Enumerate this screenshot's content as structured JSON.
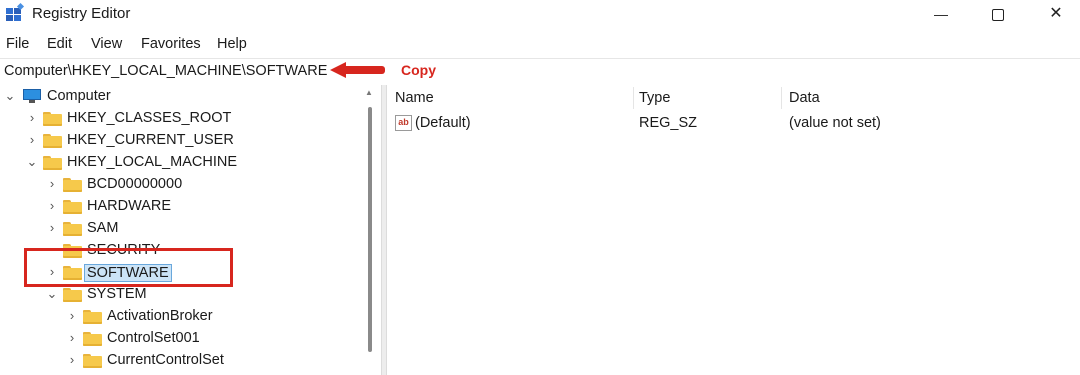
{
  "window": {
    "title": "Registry Editor",
    "minimize_glyph": "—",
    "close_glyph": "✕"
  },
  "menu": [
    "File",
    "Edit",
    "View",
    "Favorites",
    "Help"
  ],
  "address": {
    "path": "Computer\\HKEY_LOCAL_MACHINE\\SOFTWARE"
  },
  "annotation": {
    "label": "Copy",
    "color": "#d7261e"
  },
  "tree": {
    "root": "Computer",
    "items": [
      {
        "label": "HKEY_CLASSES_ROOT",
        "expanded": false
      },
      {
        "label": "HKEY_CURRENT_USER",
        "expanded": false
      },
      {
        "label": "HKEY_LOCAL_MACHINE",
        "expanded": true
      },
      {
        "label": "BCD00000000",
        "expanded": false
      },
      {
        "label": "HARDWARE",
        "expanded": false
      },
      {
        "label": "SAM",
        "expanded": false
      },
      {
        "label": "SECURITY",
        "expanded": false
      },
      {
        "label": "SOFTWARE",
        "expanded": false,
        "selected": true
      },
      {
        "label": "SYSTEM",
        "expanded": true
      },
      {
        "label": "ActivationBroker",
        "expanded": false
      },
      {
        "label": "ControlSet001",
        "expanded": false
      },
      {
        "label": "CurrentControlSet",
        "expanded": false
      }
    ],
    "chevron_right": "›",
    "chevron_down": "⌄"
  },
  "list": {
    "columns": [
      "Name",
      "Type",
      "Data"
    ],
    "rows": [
      {
        "icon": "ab",
        "name": "(Default)",
        "type": "REG_SZ",
        "data": "(value not set)"
      }
    ]
  },
  "colors": {
    "accent_red": "#d7261e",
    "selection": "#cce4f7",
    "folder": "#f6c94b"
  }
}
